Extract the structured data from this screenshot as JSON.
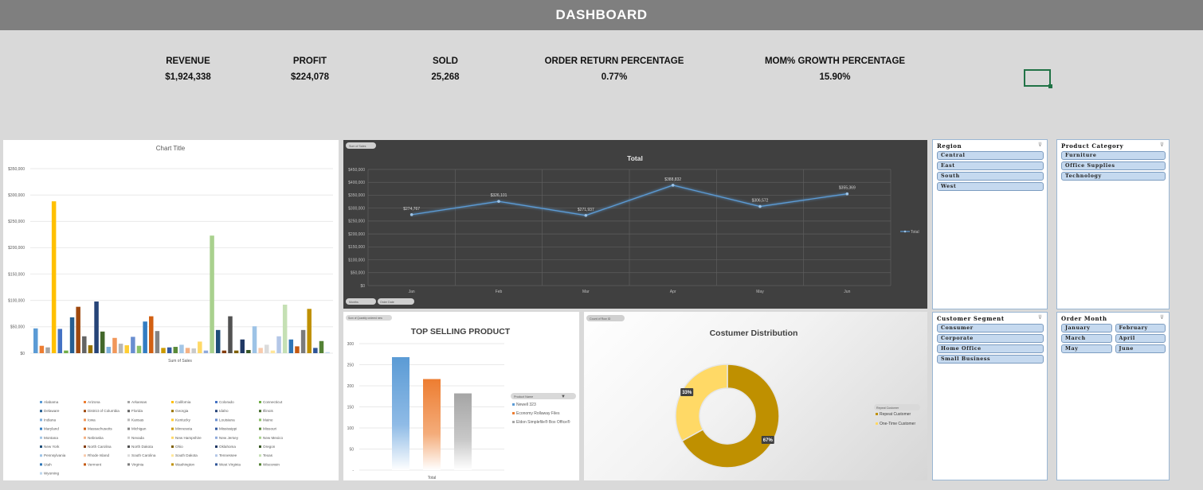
{
  "header": {
    "title": "DASHBOARD"
  },
  "kpis": [
    {
      "label": "REVENUE",
      "value": "$1,924,338"
    },
    {
      "label": "PROFIT",
      "value": "$224,078"
    },
    {
      "label": "SOLD",
      "value": "25,268"
    },
    {
      "label": "ORDER RETURN PERCENTAGE",
      "value": "0.77%"
    },
    {
      "label": "MOM% GROWTH PERCENTAGE",
      "value": "15.90%"
    }
  ],
  "chart_data": [
    {
      "type": "bar",
      "title": "Chart Title",
      "xlabel": "Sum of Sales",
      "ylim": [
        0,
        350000
      ],
      "yticks": [
        "$0",
        "$50,000",
        "$100,000",
        "$150,000",
        "$200,000",
        "$250,000",
        "$300,000",
        "$350,000"
      ],
      "legend_position": "bottom",
      "categories": [
        "Alabama",
        "Arizona",
        "Arkansas",
        "California",
        "Colorado",
        "Connecticut",
        "Delaware",
        "District of Columbia",
        "Florida",
        "Georgia",
        "Idaho",
        "Illinois",
        "Indiana",
        "Iowa",
        "Kansas",
        "Kentucky",
        "Louisiana",
        "Maine",
        "Maryland",
        "Massachusetts",
        "Michigan",
        "Minnesota",
        "Mississippi",
        "Missouri",
        "Montana",
        "Nebraska",
        "Nevada",
        "New Hampshire",
        "New Jersey",
        "New Mexico",
        "New York",
        "North Carolina",
        "North Dakota",
        "Ohio",
        "Oklahoma",
        "Oregon",
        "Pennsylvania",
        "Rhode Island",
        "South Carolina",
        "South Dakota",
        "Tennessee",
        "Texas",
        "Utah",
        "Vermont",
        "Virginia",
        "Washington",
        "West Virginia",
        "Wisconsin",
        "Wyoming"
      ],
      "values": [
        47000,
        14000,
        11000,
        288000,
        46000,
        5000,
        68000,
        88000,
        32000,
        15000,
        98000,
        41000,
        12000,
        29000,
        18000,
        15000,
        31000,
        14000,
        60000,
        70000,
        42000,
        10000,
        11000,
        12000,
        16000,
        10000,
        9000,
        22000,
        5000,
        223000,
        44000,
        5000,
        70000,
        5000,
        26000,
        6000,
        51000,
        10000,
        16000,
        5000,
        32000,
        92000,
        26000,
        13000,
        44000,
        84000,
        10000,
        23000,
        2000
      ],
      "colors": [
        "#5b9bd5",
        "#ed7d31",
        "#a5a5a5",
        "#ffc000",
        "#4472c4",
        "#70ad47",
        "#255e91",
        "#9e480e",
        "#636363",
        "#997300",
        "#264478",
        "#43682b",
        "#7cafdd",
        "#f1975a",
        "#b7b7b7",
        "#ffcd33",
        "#698ed0",
        "#8cc168",
        "#327dc2",
        "#d26012",
        "#848484",
        "#cc9a00",
        "#335aa1",
        "#5a8a39",
        "#a3c6e6",
        "#f4b183",
        "#c9c9c9",
        "#ffd966",
        "#8faadc",
        "#a9d18e",
        "#1f4e79",
        "#843c0c",
        "#525252",
        "#7f6000",
        "#203864",
        "#385723",
        "#9dc3e6",
        "#f8cbad",
        "#dbdbdb",
        "#ffe699",
        "#b4c7e7",
        "#c5e0b4",
        "#2e75b6",
        "#c55a11",
        "#7b7b7b",
        "#bf9000",
        "#2f5597",
        "#548235",
        "#bdd7ee"
      ]
    },
    {
      "type": "line",
      "title": "Total",
      "filter_button": "Sum of Sales",
      "field_buttons": [
        "Months",
        "Order Date"
      ],
      "x": [
        "Jan",
        "Feb",
        "Mar",
        "Apr",
        "May",
        "Jun"
      ],
      "ylim": [
        0,
        450000
      ],
      "yticks": [
        "$0",
        "$50,000",
        "$100,000",
        "$150,000",
        "$200,000",
        "$250,000",
        "$300,000",
        "$350,000",
        "$400,000",
        "$450,000"
      ],
      "series": [
        {
          "name": "Total",
          "values": [
            274767,
            326101,
            271937,
            388832,
            306572,
            355369
          ],
          "labels": [
            "$274,767",
            "$326,101",
            "$271,937",
            "$388,832",
            "$306,572",
            "$355,369"
          ]
        }
      ],
      "legend_position": "right",
      "grid": true
    },
    {
      "type": "bar",
      "title": "TOP SELLING PRODUCT",
      "filter_button": "Sum of Quantity ordered new",
      "xlabel": "Total",
      "ylim": [
        0,
        300
      ],
      "yticks": [
        "-",
        "50",
        "100",
        "150",
        "200",
        "250",
        "300"
      ],
      "legend_field": "Product Name",
      "series": [
        {
          "name": "Newell 323",
          "values": [
            268
          ],
          "color": "#5b9bd5"
        },
        {
          "name": "Economy Rollaway Files",
          "values": [
            216
          ],
          "color": "#ed7d31"
        },
        {
          "name": "Eldon Simplefile® Box Office®",
          "values": [
            182
          ],
          "color": "#a5a5a5"
        }
      ],
      "grid": true
    },
    {
      "type": "pie",
      "title": "Costumer Distribution",
      "filter_button": "Count of Row ID",
      "legend_field": "Repeat Customer",
      "slices": [
        {
          "name": "Repeat Customer",
          "value": 67,
          "label": "67%",
          "color": "#bf9000"
        },
        {
          "name": "One-Time Customer",
          "value": 33,
          "label": "33%",
          "color": "#ffd966"
        }
      ]
    }
  ],
  "slicers": {
    "region": {
      "title": "Region",
      "items": [
        "Central",
        "East",
        "South",
        "West"
      ]
    },
    "category": {
      "title": "Product Category",
      "items": [
        "Furniture",
        "Office Supplies",
        "Technology"
      ]
    },
    "segment": {
      "title": "Customer Segment",
      "items": [
        "Consumer",
        "Corporate",
        "Home Office",
        "Small Business"
      ]
    },
    "month": {
      "title": "Order Month",
      "items": [
        "January",
        "February",
        "March",
        "April",
        "May",
        "June"
      ]
    }
  },
  "icons": {
    "filter": "filter-icon",
    "clear_filter": "clear-filter-icon"
  }
}
